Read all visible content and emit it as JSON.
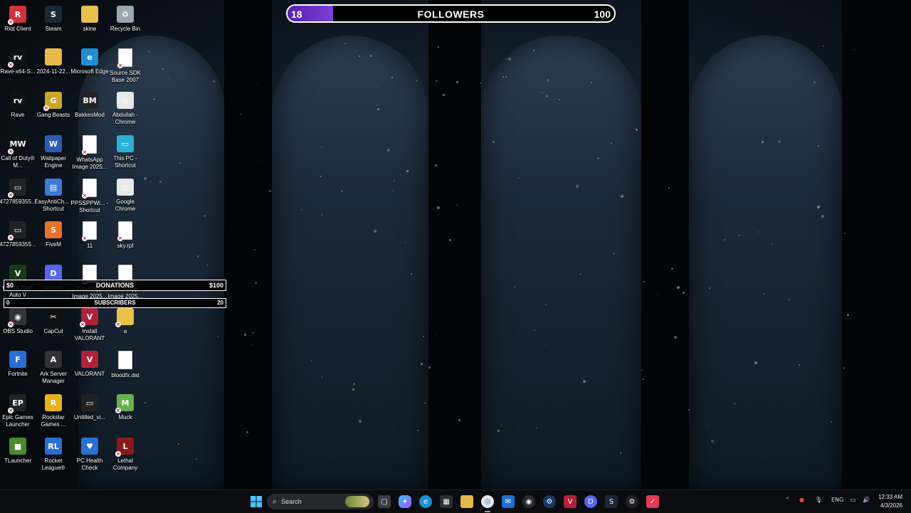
{
  "desktop": {
    "icons": [
      {
        "label": "Riot Client",
        "icon": "riot-icon",
        "color": "#d1313c",
        "glyph": "R"
      },
      {
        "label": "Rave-x64-S...",
        "icon": "rave-icon",
        "color": "#111",
        "glyph": "rv"
      },
      {
        "label": "Rave",
        "icon": "rave-icon",
        "color": "#111",
        "glyph": "rv"
      },
      {
        "label": "Call of Duty® M...",
        "icon": "cod-icon",
        "color": "#111",
        "glyph": "MW"
      },
      {
        "label": "4727859355...",
        "icon": "video-icon",
        "color": "#222",
        "glyph": "▭"
      },
      {
        "label": "4727859355...",
        "icon": "video-icon",
        "color": "#222",
        "glyph": "▭"
      },
      {
        "label": "Grand Theft Auto V",
        "icon": "gta-icon",
        "color": "#1a3a1a",
        "glyph": "V"
      },
      {
        "label": "OBS Studio",
        "icon": "obs-icon",
        "color": "#333",
        "glyph": "◉"
      },
      {
        "label": "Fortnite",
        "icon": "fortnite-icon",
        "color": "#2a6fd1",
        "glyph": "F"
      },
      {
        "label": "Epic Games Launcher",
        "icon": "epic-icon",
        "color": "#222",
        "glyph": "EP"
      },
      {
        "label": "TLauncher",
        "icon": "minecraft-icon",
        "color": "#4a8a2a",
        "glyph": "■"
      },
      {
        "label": "Steam",
        "icon": "steam-icon",
        "color": "#1b2838",
        "glyph": "S"
      },
      {
        "label": "2024-11-22...",
        "icon": "folder-icon",
        "color": "#e8b84a",
        "glyph": ""
      },
      {
        "label": "Gang Beasts",
        "icon": "gangbeasts-icon",
        "color": "#caa72a",
        "glyph": "G"
      },
      {
        "label": "Wallpaper Engine",
        "icon": "wallpaper-engine-icon",
        "color": "#2a5bb8",
        "glyph": "W"
      },
      {
        "label": "EasyAntiCh... - Shortcut",
        "icon": "shortcut-icon",
        "color": "#3a7bd5",
        "glyph": "▤"
      },
      {
        "label": "FiveM",
        "icon": "fivem-icon",
        "color": "#e8722a",
        "glyph": "5"
      },
      {
        "label": "Discord",
        "icon": "discord-icon",
        "color": "#5865f2",
        "glyph": "D"
      },
      {
        "label": "CapCut",
        "icon": "capcut-icon",
        "color": "#111",
        "glyph": "✂"
      },
      {
        "label": "Ark Server Manager",
        "icon": "ark-icon",
        "color": "#333",
        "glyph": "A"
      },
      {
        "label": "Rockstar Games ...",
        "icon": "rockstar-icon",
        "color": "#e8b21a",
        "glyph": "R"
      },
      {
        "label": "Rocket League®",
        "icon": "rocket-league-icon",
        "color": "#2a6fd1",
        "glyph": "RL"
      },
      {
        "label": "skine",
        "icon": "folder-icon",
        "color": "#e8c04a",
        "glyph": ""
      },
      {
        "label": "Microsoft Edge",
        "icon": "edge-icon",
        "color": "#1f8fd1",
        "glyph": "e"
      },
      {
        "label": "BakkesMod",
        "icon": "bakkesmod-icon",
        "color": "#222",
        "glyph": "BM"
      },
      {
        "label": "WhatsApp Image 2025...",
        "icon": "image-file-icon",
        "color": "#fff",
        "glyph": ""
      },
      {
        "label": "PPSSPPWi... - Shortcut",
        "icon": "shortcut-icon",
        "color": "#fff",
        "glyph": ""
      },
      {
        "label": "11",
        "icon": "image-file-icon",
        "color": "#fff",
        "glyph": ""
      },
      {
        "label": "WhatsApp Image 2025...",
        "icon": "image-file-icon",
        "color": "#fff",
        "glyph": ""
      },
      {
        "label": "Install VALORANT",
        "icon": "valorant-icon",
        "color": "#b0213a",
        "glyph": "V"
      },
      {
        "label": "VALORANT",
        "icon": "valorant-icon",
        "color": "#b0213a",
        "glyph": "V"
      },
      {
        "label": "Untitled_vi...",
        "icon": "video-icon",
        "color": "#222",
        "glyph": "▭"
      },
      {
        "label": "PC Health Check",
        "icon": "pc-health-icon",
        "color": "#2a6fd1",
        "glyph": "♥"
      },
      {
        "label": "Recycle Bin",
        "icon": "recycle-bin-icon",
        "color": "#9aa6b0",
        "glyph": "♻"
      },
      {
        "label": "Source SDK Base 2007",
        "icon": "file-icon",
        "color": "#fff",
        "glyph": ""
      },
      {
        "label": "Abdullah - Chrome",
        "icon": "chrome-icon",
        "color": "#e8e8e8",
        "glyph": "◎"
      },
      {
        "label": "This PC - Shortcut",
        "icon": "this-pc-icon",
        "color": "#2ab0d8",
        "glyph": "▭"
      },
      {
        "label": "Google Chrome",
        "icon": "chrome-icon",
        "color": "#e8e8e8",
        "glyph": "◎"
      },
      {
        "label": "sky.rpf",
        "icon": "file-icon",
        "color": "#fff",
        "glyph": ""
      },
      {
        "label": "WhatsApp Image 2025...",
        "icon": "image-file-icon",
        "color": "#fff",
        "glyph": ""
      },
      {
        "label": "a",
        "icon": "folder-icon",
        "color": "#e8c04a",
        "glyph": ""
      },
      {
        "label": "bloodfx.dat",
        "icon": "file-icon",
        "color": "#fff",
        "glyph": ""
      },
      {
        "label": "Muck",
        "icon": "muck-icon",
        "color": "#6ab04a",
        "glyph": "M"
      },
      {
        "label": "Lethal Company",
        "icon": "lethal-company-icon",
        "color": "#8a1a1a",
        "glyph": "L"
      }
    ]
  },
  "followers_goal": {
    "start": "18",
    "title": "FOLLOWERS",
    "goal": "100",
    "progress": 0.14,
    "fill_color": "#7a3fd6"
  },
  "donations_goal": {
    "start": "$0",
    "title": "DONATIONS",
    "goal": "$100",
    "progress": 0
  },
  "subscribers_goal": {
    "start": "0",
    "title": "SUBSCRIBERS",
    "goal": "20",
    "progress": 0
  },
  "taskbar": {
    "search_label": "Search",
    "language": "ENG",
    "time": "12:33 AM",
    "date": "4/3/2026",
    "apps": [
      "start-icon",
      "search-box",
      "widgets-icon",
      "task-view-icon",
      "copilot-icon",
      "edge-icon",
      "store-icon",
      "file-explorer-icon",
      "chrome-icon",
      "outlook-icon",
      "obs-icon",
      "ark-icon",
      "valorant-icon",
      "discord-icon",
      "steam-icon",
      "rave-icon",
      "capcut-icon"
    ]
  }
}
